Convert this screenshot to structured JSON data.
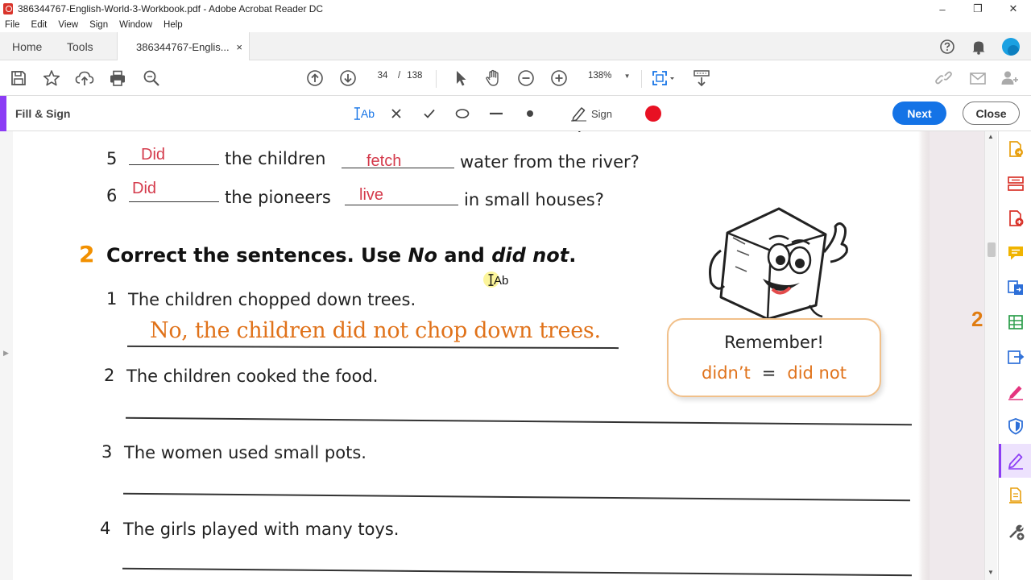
{
  "window": {
    "title": "386344767-English-World-3-Workbook.pdf - Adobe Acrobat Reader DC",
    "controls": [
      "–",
      "❐",
      "✕"
    ]
  },
  "menu": [
    "File",
    "Edit",
    "View",
    "Sign",
    "Window",
    "Help"
  ],
  "tabs": {
    "home": "Home",
    "tools": "Tools",
    "doc": "386344767-Englis...",
    "doc_close": "×"
  },
  "toolbar": {
    "page_current": "34",
    "page_sep": "/",
    "page_total": "138",
    "zoom": "138%",
    "zoom_caret": "▼"
  },
  "fillsign": {
    "label": "Fill & Sign",
    "text_tool": "Ab",
    "sign_label": "Sign",
    "next_label": "Next",
    "close_label": "Close",
    "color_accent": "#8c3cf5",
    "dot_color": "#e81123"
  },
  "page": {
    "q5_num": "5",
    "q5_ans1": "Did",
    "q5_mid": "the children",
    "q5_ans2": "fetch",
    "q5_end": "water from the river?",
    "q6_num": "6",
    "q6_ans1": "Did",
    "q6_mid": "the pioneers",
    "q6_ans2": "live",
    "q6_end": "in small houses?",
    "ex2_num": "2",
    "ex2_title_a": "Correct the sentences. Use ",
    "ex2_title_no": "No",
    "ex2_title_b": " and ",
    "ex2_title_didnot": "did not",
    "ex2_title_c": ".",
    "s1_num": "1",
    "s1": "The children chopped down trees.",
    "s1_answer": "No, the children did not chop down trees.",
    "s2_num": "2",
    "s2": "The children cooked the food.",
    "s3_num": "3",
    "s3": "The women used small pots.",
    "s4_num": "4",
    "s4": "The girls played with many toys.",
    "remember_title": "Remember!",
    "remember_left": "didn’t",
    "remember_eq": "=",
    "remember_right": "did not",
    "cursor_label": "Ab",
    "next_page_num": "2"
  },
  "colors": {
    "answer_red": "#d43b4c",
    "handwriting_orange": "#e0721a",
    "exercise_num": "#f29000",
    "primary_blue": "#1473e6"
  }
}
